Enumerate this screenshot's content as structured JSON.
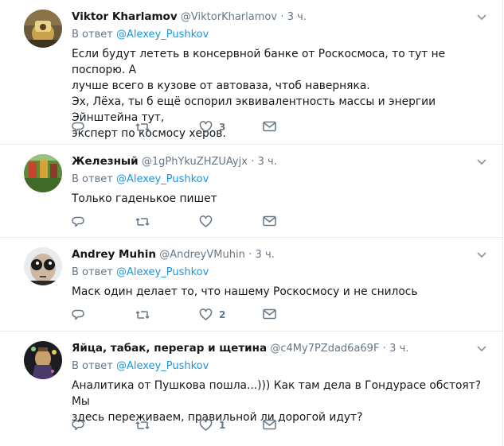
{
  "colors": {
    "link": "#1b95e0",
    "muted": "#657786",
    "text": "#14171a",
    "border": "#e6ecf0"
  },
  "tweets": [
    {
      "fullname": "Viktor Kharlamov",
      "username": "@ViktorKharlamov",
      "dot": "·",
      "time": "3 ч.",
      "reply_prefix": "В ответ",
      "reply_to": "@Alexey_Pushkov",
      "text_lines": [
        "Если будут лететь в консервной банке от Роскосмоса, то тут не поспорю. А",
        "лучше всего в кузове от автоваза, чтоб наверняка.",
        "Эх, Лёха, ты б ещё оспорил эквивалентность массы и энергии Эйнштейна тут,",
        "эксперт по космосу херов."
      ],
      "like_count": "3",
      "retweet_count": ""
    },
    {
      "fullname": "Железный",
      "username": "@1gPhYkuZHZUAyjx",
      "dot": "·",
      "time": "3 ч.",
      "reply_prefix": "В ответ",
      "reply_to": "@Alexey_Pushkov",
      "text_lines": [
        "Только гаденькое пишет"
      ],
      "like_count": "",
      "retweet_count": ""
    },
    {
      "fullname": "Andrey Muhin",
      "username": "@AndreyVMuhin",
      "dot": "·",
      "time": "3 ч.",
      "reply_prefix": "В ответ",
      "reply_to": "@Alexey_Pushkov",
      "text_lines": [
        "Маск один делает то, что нашему Роскосмосу и не снилось"
      ],
      "like_count": "2",
      "retweet_count": ""
    },
    {
      "fullname": "Яйца, табак, перегар и щетина",
      "username": "@c4My7PZdad6a69F",
      "dot": "·",
      "time": "3 ч.",
      "reply_prefix": "В ответ",
      "reply_to": "@Alexey_Pushkov",
      "text_lines": [
        "Аналитика от Пушкова пошла...))) Как там дела в Гондурасе обстоят? Мы",
        "здесь переживаем, правильной ли дорогой идут?"
      ],
      "like_count": "1",
      "retweet_count": ""
    }
  ],
  "icons": {
    "reply": "reply-icon",
    "retweet": "retweet-icon",
    "like": "heart-icon",
    "dm": "envelope-icon",
    "caret": "chevron-down-icon"
  }
}
